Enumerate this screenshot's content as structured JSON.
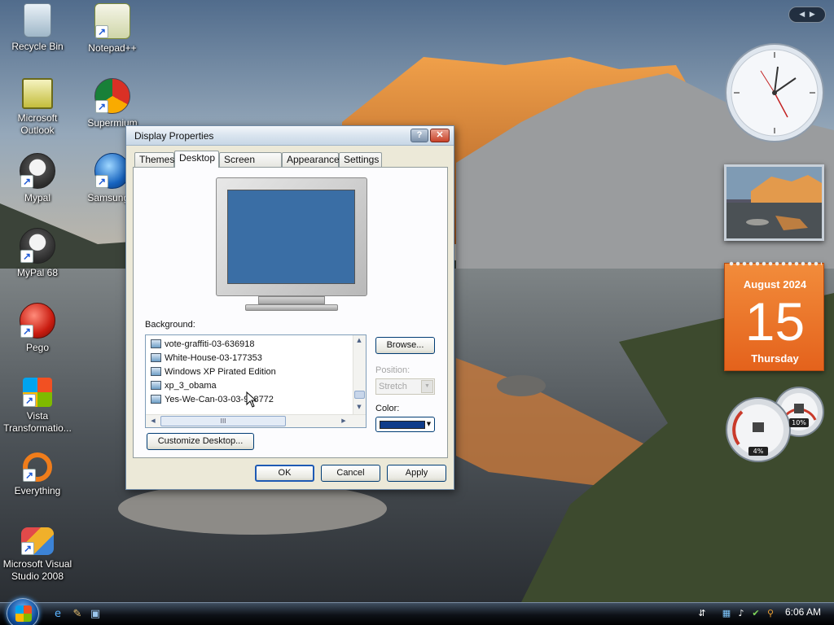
{
  "desktop": {
    "icons": [
      {
        "label": "Recycle Bin"
      },
      {
        "label": "Notepad++"
      },
      {
        "label": "Microsoft Outlook"
      },
      {
        "label": "Supermium"
      },
      {
        "label": "Mypal"
      },
      {
        "label": "Samsung T"
      },
      {
        "label": "MyPal 68"
      },
      {
        "label": "Pego"
      },
      {
        "label": "Vista Transformatio..."
      },
      {
        "label": "Everything"
      },
      {
        "label": "Microsoft Visual Studio 2008"
      }
    ]
  },
  "window": {
    "title": "Display Properties",
    "help_glyph": "?",
    "close_glyph": "✕",
    "tabs": [
      {
        "label": "Themes"
      },
      {
        "label": "Desktop",
        "active": true
      },
      {
        "label": "Screen Saver"
      },
      {
        "label": "Appearance"
      },
      {
        "label": "Settings"
      }
    ],
    "background_label": "Background:",
    "background_items": [
      "vote-graffiti-03-636918",
      "White-House-03-177353",
      "Windows XP Pirated Edition",
      "xp_3_obama",
      "Yes-We-Can-03-03-918772"
    ],
    "hscroll_grip": "III",
    "browse_label": "Browse...",
    "position_label": "Position:",
    "position_value": "Stretch",
    "color_label": "Color:",
    "color_value": "#0f3c8a",
    "customize_label": "Customize Desktop...",
    "ok_label": "OK",
    "cancel_label": "Cancel",
    "apply_label": "Apply"
  },
  "gadgets": {
    "calendar": {
      "month": "August 2024",
      "day": "15",
      "weekday": "Thursday"
    },
    "meter": {
      "cpu": "4%",
      "memory": "10%"
    }
  },
  "taskbar": {
    "time": "6:06 AM"
  },
  "colors": {
    "window_bg": "#ece9d8",
    "calendar_orange": "#e4621c",
    "monitor_screen": "#3a6ea5"
  }
}
